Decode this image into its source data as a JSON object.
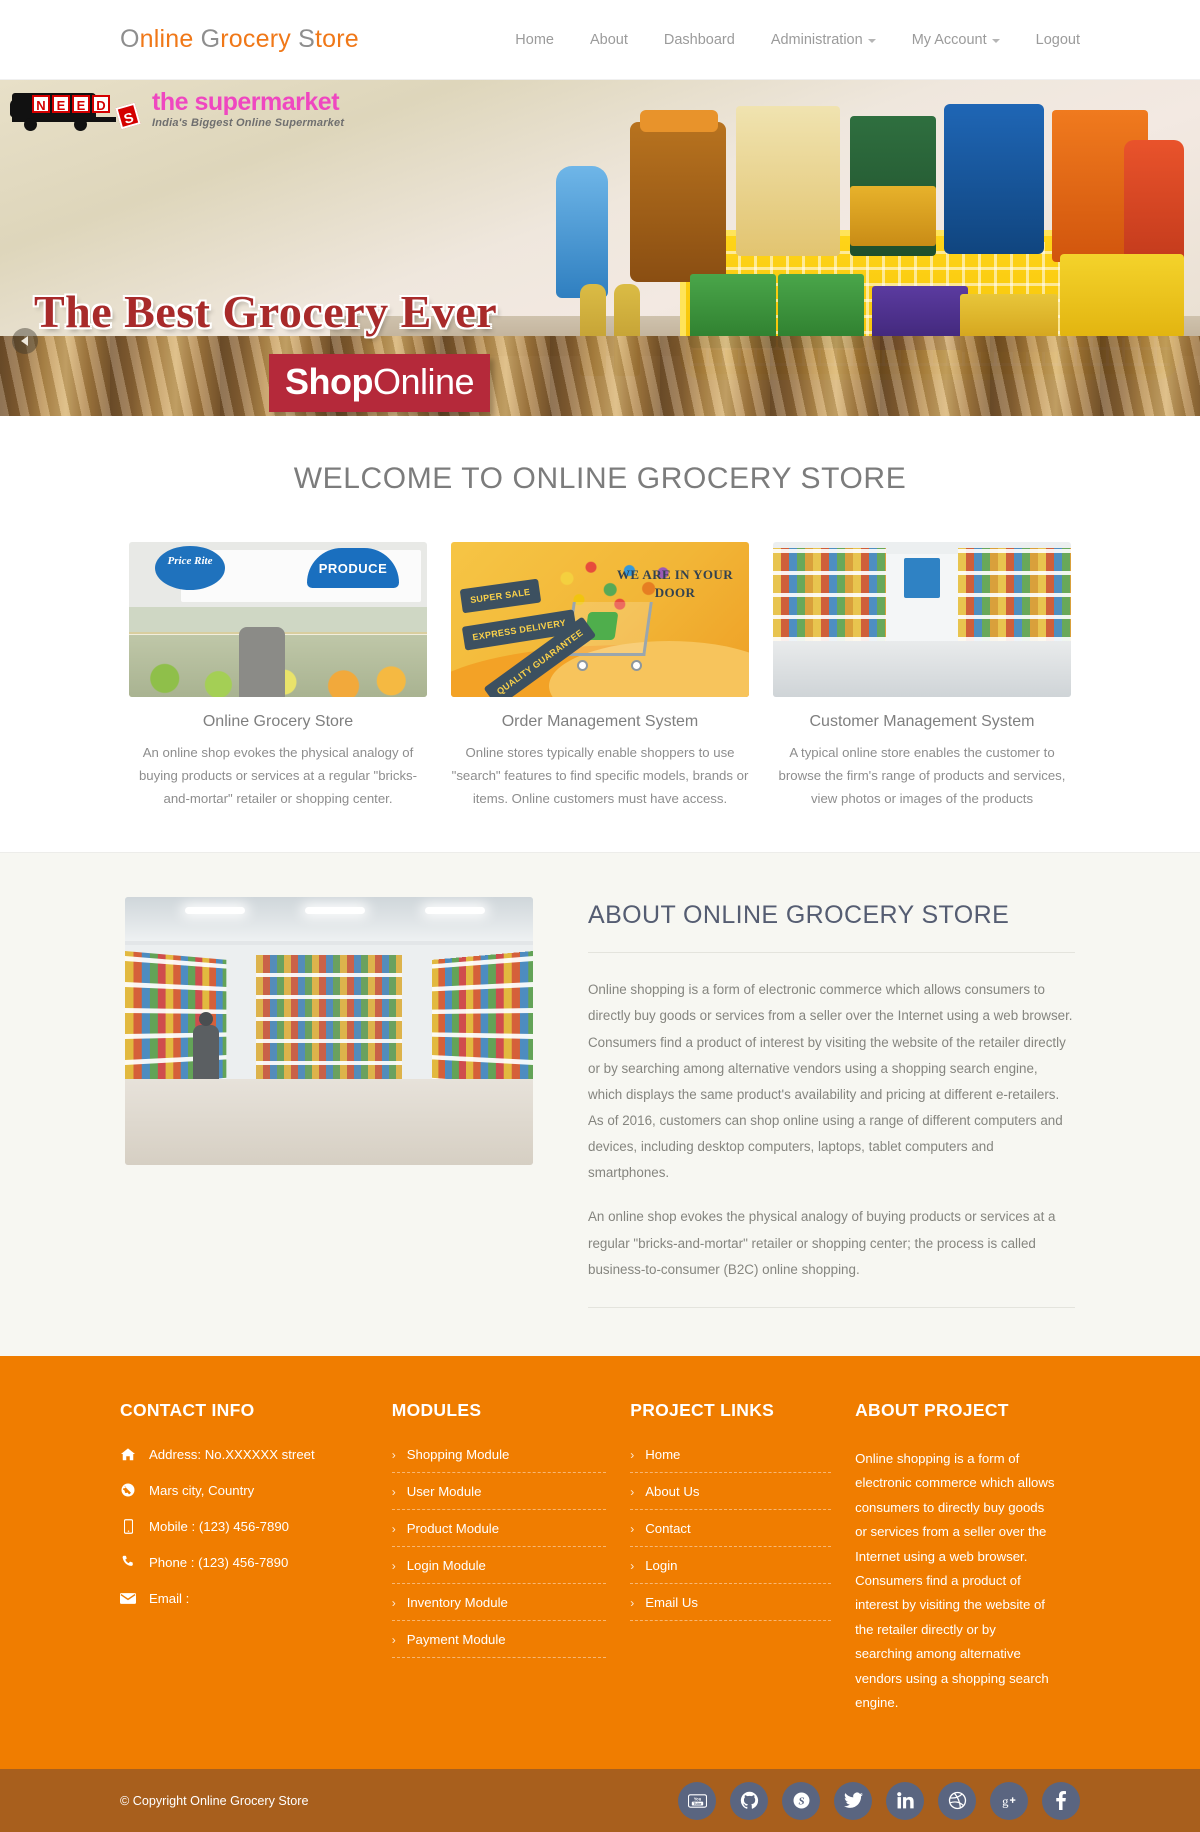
{
  "header": {
    "brand": {
      "parts": [
        {
          "t": "O",
          "c": "gray"
        },
        {
          "t": "nline ",
          "c": "orange"
        },
        {
          "t": "G",
          "c": "gray"
        },
        {
          "t": "rocery ",
          "c": "orange"
        },
        {
          "t": "S",
          "c": "gray"
        },
        {
          "t": "tore",
          "c": "orange"
        }
      ],
      "full": "Online Grocery Store"
    },
    "nav": [
      {
        "label": "Home",
        "caret": false
      },
      {
        "label": "About",
        "caret": false
      },
      {
        "label": "Dashboard",
        "caret": false
      },
      {
        "label": "Administration",
        "caret": true
      },
      {
        "label": "My Account",
        "caret": true
      },
      {
        "label": "Logout",
        "caret": false
      }
    ]
  },
  "hero": {
    "logo_needs": "NEEDS",
    "logo_letters": [
      "N",
      "E",
      "E",
      "D"
    ],
    "logo_s": "S",
    "logo_main": "the supermarket",
    "logo_sub": "India's Biggest Online Supermarket",
    "title": "The Best Grocery Ever",
    "badge_bold": "Shop",
    "badge_thin": "Online",
    "prev_label": "Previous slide"
  },
  "welcome": {
    "title": "WELCOME TO ONLINE GROCERY STORE",
    "features": [
      {
        "title": "Online Grocery Store",
        "text": "An online shop evokes the physical analogy of buying products or services at a regular \"bricks-and-mortar\" retailer or shopping center.",
        "image_alt": "Price Rite PRODUCE supermarket produce aisle",
        "image_labels": {
          "brand": "Price Rite",
          "sign": "PRODUCE"
        }
      },
      {
        "title": "Order Management System",
        "text": "Online stores typically enable shoppers to use \"search\" features to find specific models, brands or items. Online customers must have access.",
        "image_alt": "Shopping cart delivery illustration",
        "image_labels": {
          "tag1": "SUPER SALE",
          "tag2": "EXPRESS DELIVERY",
          "tag3": "QUALITY GUARANTEE",
          "headline": "WE ARE IN YOUR DOOR"
        }
      },
      {
        "title": "Customer Management System",
        "text": "A typical online store enables the customer to browse the firm's range of products and services, view photos or images of the products",
        "image_alt": "Grocery store canned goods aisle",
        "image_labels": {}
      }
    ]
  },
  "about": {
    "title": "ABOUT ONLINE GROCERY STORE",
    "image_alt": "Supermarket aisle with shopper",
    "paragraphs": [
      "Online shopping is a form of electronic commerce which allows consumers to directly buy goods or services from a seller over the Internet using a web browser. Consumers find a product of interest by visiting the website of the retailer directly or by searching among alternative vendors using a shopping search engine, which displays the same product's availability and pricing at different e-retailers. As of 2016, customers can shop online using a range of different computers and devices, including desktop computers, laptops, tablet computers and smartphones.",
      "An online shop evokes the physical analogy of buying products or services at a regular \"bricks-and-mortar\" retailer or shopping center; the process is called business-to-consumer (B2C) online shopping."
    ]
  },
  "footer": {
    "contact": {
      "title": "CONTACT INFO",
      "lines": [
        {
          "icon": "home-icon",
          "text": "Address: No.XXXXXX street"
        },
        {
          "icon": "globe-icon",
          "text": "Mars city, Country"
        },
        {
          "icon": "mobile-icon",
          "text": "Mobile : (123) 456-7890"
        },
        {
          "icon": "phone-icon",
          "text": "Phone : (123) 456-7890"
        },
        {
          "icon": "envelope-icon",
          "text": "Email :"
        }
      ]
    },
    "modules": {
      "title": "MODULES",
      "links": [
        "Shopping Module",
        "User Module",
        "Product Module",
        "Login Module",
        "Inventory Module",
        "Payment Module"
      ]
    },
    "project_links": {
      "title": "PROJECT LINKS",
      "links": [
        "Home",
        "About Us",
        "Contact",
        "Login",
        "Email Us"
      ]
    },
    "about_project": {
      "title": "ABOUT PROJECT",
      "text": "Online shopping is a form of electronic commerce which allows consumers to directly buy goods or services from a seller over the Internet using a web browser. Consumers find a product of interest by visiting the website of the retailer directly or by searching among alternative vendors using a shopping search engine."
    },
    "chevron": "›"
  },
  "copyright": {
    "text": "© Copyright Online Grocery Store",
    "socials": [
      "youtube-icon",
      "github-icon",
      "skype-icon",
      "twitter-icon",
      "linkedin-icon",
      "dribbble-icon",
      "google-plus-icon",
      "facebook-icon"
    ]
  },
  "colors": {
    "brand_orange": "#f07818",
    "footer_orange": "#f07d00",
    "copybar_brown": "#a85f1d",
    "social_slate": "#5a6580",
    "hero_red": "#b5293a",
    "about_heading": "#555d72"
  }
}
